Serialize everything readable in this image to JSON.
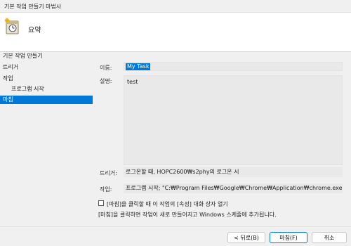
{
  "window": {
    "title": "기본 작업 만들기 마법사"
  },
  "header": {
    "title": "요약",
    "icon": "task-clock-icon"
  },
  "sidebar": {
    "items": [
      {
        "label": "기본 작업 만들기"
      },
      {
        "label": "트리거"
      },
      {
        "label": "작업"
      },
      {
        "label": "프로그램 시작"
      },
      {
        "label": "마침"
      }
    ],
    "selected_index": 4
  },
  "form": {
    "name_label": "이름:",
    "name_value": "My Task",
    "description_label": "설명:",
    "description_value": "test",
    "trigger_label": "트리거:",
    "trigger_value": "로그온할 때, HOPC2600₩s2phy의 로그온 시",
    "action_label": "작업:",
    "action_value": "프로그램 시작; \"C:₩Program Files₩Google₩Chrome₩Application₩chrome.exe\""
  },
  "options": {
    "open_properties_label": "[마침]을 클릭할 때 이 작업의 [속성] 대화 상자 열기",
    "open_properties_checked": false,
    "hint_text": "[마침]을 클릭하면 작업이 새로 만들어지고 Windows 스케줄에 추가됩니다."
  },
  "buttons": {
    "back": "< 뒤로(B)",
    "finish": "마침(F)",
    "cancel": "취소"
  }
}
